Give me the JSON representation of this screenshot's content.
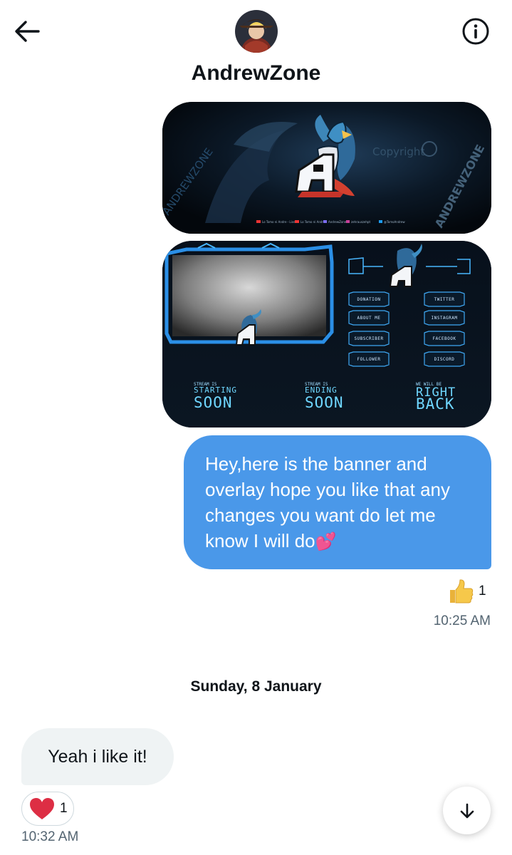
{
  "header": {
    "contact_name": "AndrewZone",
    "back_icon": "arrow-left-icon",
    "info_icon": "info-icon"
  },
  "media": {
    "banner": {
      "watermark": "ANDREWZONE",
      "copyright_text": "Copyright",
      "social_links": [
        "Lo Tomo ni Andre - Live",
        "Lo Tomo ni Andre",
        "AndrewZone",
        "zehrauszehpt",
        "@TomoAndrew"
      ]
    },
    "overlay": {
      "panels_left": [
        "DONATION",
        "ABOUT ME",
        "SUBSCRIBER",
        "FOLLOWER"
      ],
      "panels_right": [
        "TWITTER",
        "INSTAGRAM",
        "FACEBOOK",
        "DISCORD"
      ],
      "screens": [
        {
          "small": "STREAM IS",
          "line1": "STARTING",
          "line2": "SOON"
        },
        {
          "small": "STREAM IS",
          "line1": "ENDING",
          "line2": "SOON"
        },
        {
          "small": "WE WILL BE",
          "line1": "RIGHT",
          "line2": "BACK"
        }
      ]
    }
  },
  "messages": {
    "outgoing": {
      "text": "Hey,here is the banner and overlay hope you like that any changes you want do let me know I will do",
      "emoji": "💕",
      "reaction_count": "1",
      "time": "10:25 AM"
    },
    "date_separator": "Sunday, 8 January",
    "incoming": {
      "text": "Yeah i like it!",
      "reaction_count": "1",
      "time": "10:32 AM"
    }
  },
  "colors": {
    "outgoing_bubble": "#4a98e9",
    "incoming_bubble": "#eff3f4",
    "heart": "#e0245e",
    "thumbs": "#f6c84a"
  }
}
